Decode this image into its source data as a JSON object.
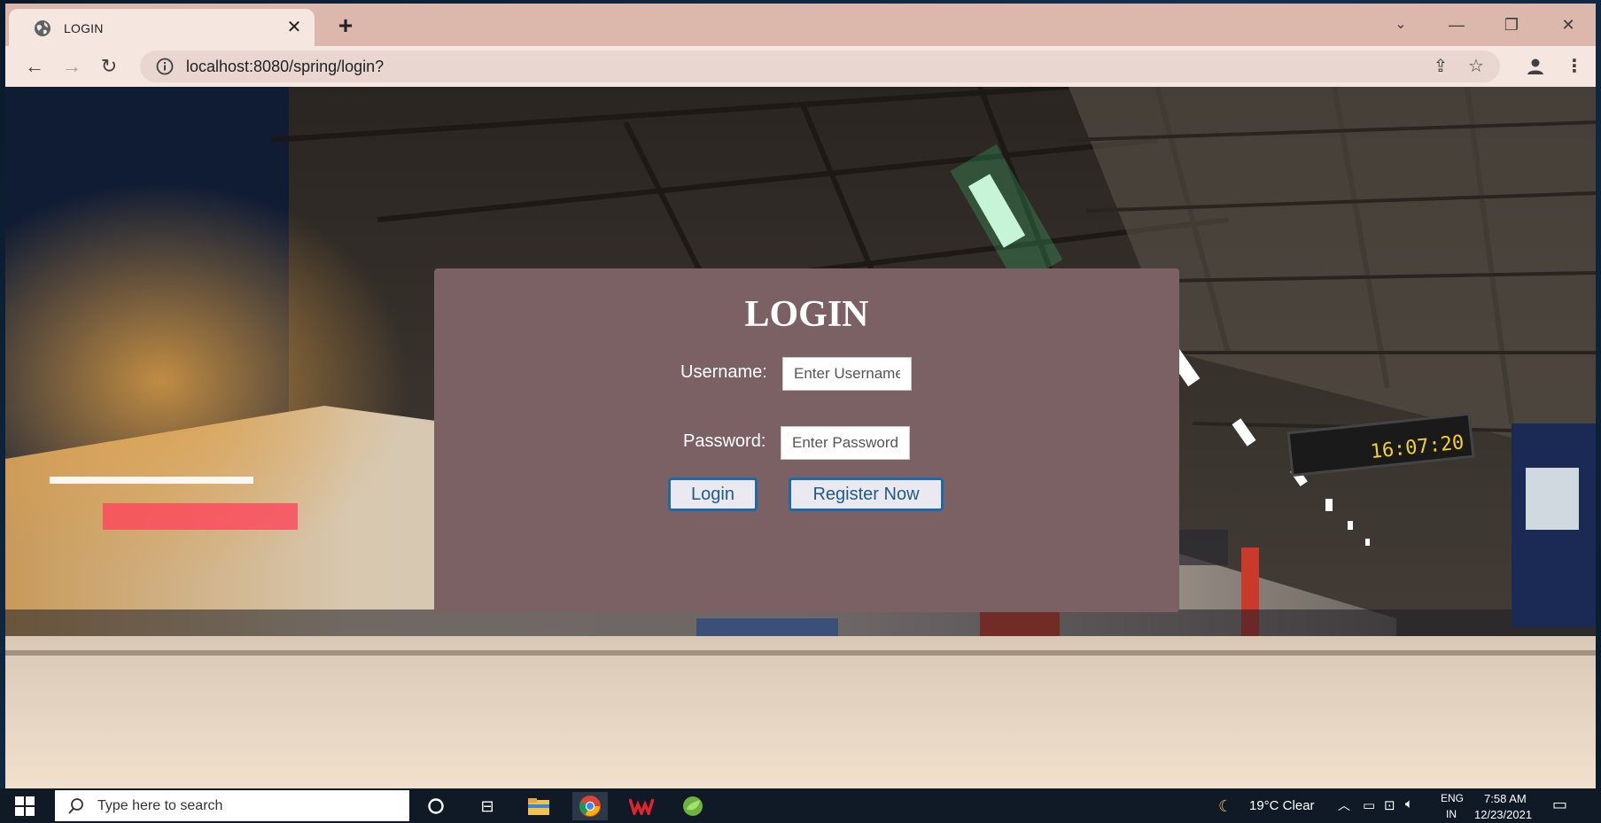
{
  "browser": {
    "tab_title": "LOGIN",
    "url": "localhost:8080/spring/login?"
  },
  "icons": {
    "favicon": "globe-icon",
    "tab_close": "close-icon",
    "new_tab": "plus-icon",
    "back": "arrow-left-icon",
    "forward": "arrow-right-icon",
    "reload": "reload-icon",
    "site_info": "info-icon",
    "share": "share-icon",
    "bookmark": "star-icon",
    "profile": "profile-icon",
    "menu": "kebab-menu-icon"
  },
  "login": {
    "title": "LOGIN",
    "username_label": "Username:",
    "username_placeholder": "Enter Username",
    "password_label": "Password:",
    "password_placeholder": "Enter Password",
    "login_button": "Login",
    "register_button": "Register Now"
  },
  "taskbar": {
    "search_placeholder": "Type here to search",
    "weather": "19°C  Clear",
    "lang_top": "ENG",
    "lang_bottom": "IN",
    "time": "7:58 AM",
    "date": "12/23/2021"
  },
  "colors": {
    "panel": "#7c6164",
    "button_border": "#1e6aa8",
    "tab_bar": "#dcb8ac",
    "taskbar": "#0f1a26"
  }
}
